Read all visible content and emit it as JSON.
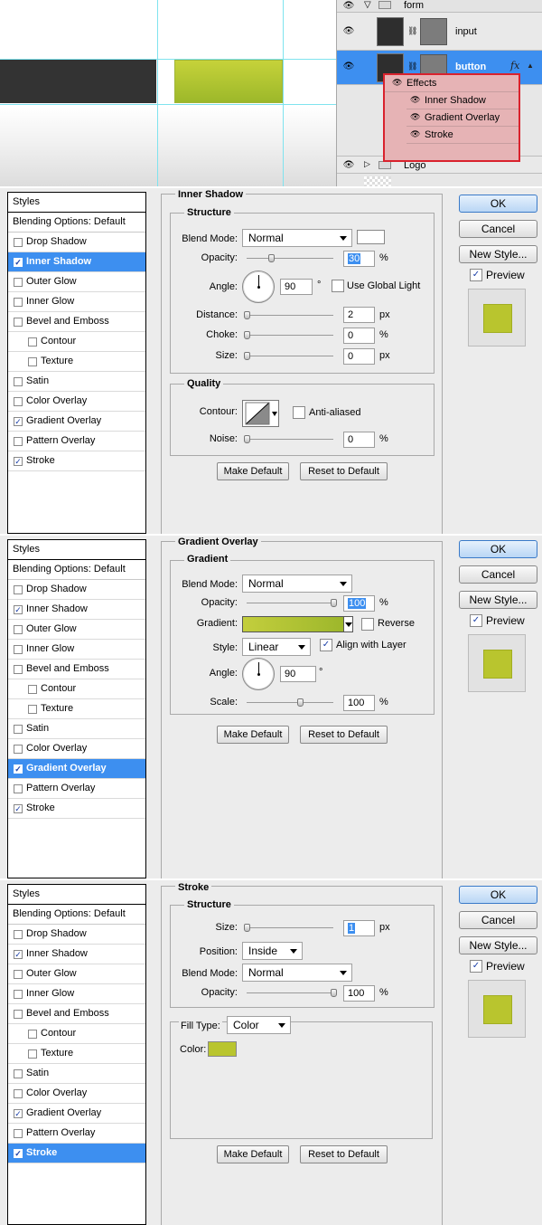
{
  "layers_panel": {
    "group_form": "form",
    "layer_input": "input",
    "layer_button": "button",
    "fx": "fx",
    "effects_label": "Effects",
    "effects": [
      "Inner Shadow",
      "Gradient Overlay",
      "Stroke"
    ],
    "group_logo": "Logo"
  },
  "styles_list": {
    "header": "Styles",
    "blending": "Blending Options: Default",
    "items": [
      "Drop Shadow",
      "Inner Shadow",
      "Outer Glow",
      "Inner Glow",
      "Bevel and Emboss",
      "Contour",
      "Texture",
      "Satin",
      "Color Overlay",
      "Gradient Overlay",
      "Pattern Overlay",
      "Stroke"
    ]
  },
  "buttons": {
    "ok": "OK",
    "cancel": "Cancel",
    "new_style": "New Style...",
    "preview": "Preview",
    "make_default": "Make Default",
    "reset_default": "Reset to Default"
  },
  "inner_shadow": {
    "title": "Inner Shadow",
    "structure": "Structure",
    "blend_mode_label": "Blend Mode:",
    "blend_mode": "Normal",
    "opacity_label": "Opacity:",
    "opacity": "30",
    "opacity_unit": "%",
    "angle_label": "Angle:",
    "angle": "90",
    "angle_unit": "°",
    "use_global_light": "Use Global Light",
    "distance_label": "Distance:",
    "distance": "2",
    "distance_unit": "px",
    "choke_label": "Choke:",
    "choke": "0",
    "choke_unit": "%",
    "size_label": "Size:",
    "size": "0",
    "size_unit": "px",
    "quality": "Quality",
    "contour_label": "Contour:",
    "anti_aliased": "Anti-aliased",
    "noise_label": "Noise:",
    "noise": "0",
    "noise_unit": "%",
    "shadow_color": "#ffffff"
  },
  "gradient_overlay": {
    "title": "Gradient Overlay",
    "section": "Gradient",
    "blend_mode_label": "Blend Mode:",
    "blend_mode": "Normal",
    "opacity_label": "Opacity:",
    "opacity": "100",
    "opacity_unit": "%",
    "gradient_label": "Gradient:",
    "reverse": "Reverse",
    "style_label": "Style:",
    "style": "Linear",
    "align_with_layer": "Align with Layer",
    "angle_label": "Angle:",
    "angle": "90",
    "angle_unit": "°",
    "scale_label": "Scale:",
    "scale": "100",
    "scale_unit": "%",
    "gradient_start": "#c3ce3d",
    "gradient_end": "#9ab52a"
  },
  "stroke": {
    "title": "Stroke",
    "structure": "Structure",
    "size_label": "Size:",
    "size": "1",
    "size_unit": "px",
    "position_label": "Position:",
    "position": "Inside",
    "blend_mode_label": "Blend Mode:",
    "blend_mode": "Normal",
    "opacity_label": "Opacity:",
    "opacity": "100",
    "opacity_unit": "%",
    "fill_type_label": "Fill Type:",
    "fill_type": "Color",
    "color_label": "Color:",
    "color": "#b9c52e"
  },
  "colors": {
    "selection": "#3d8ff0",
    "highlight_box": "#d9222d",
    "preview_swatch": "#b9c52e"
  }
}
